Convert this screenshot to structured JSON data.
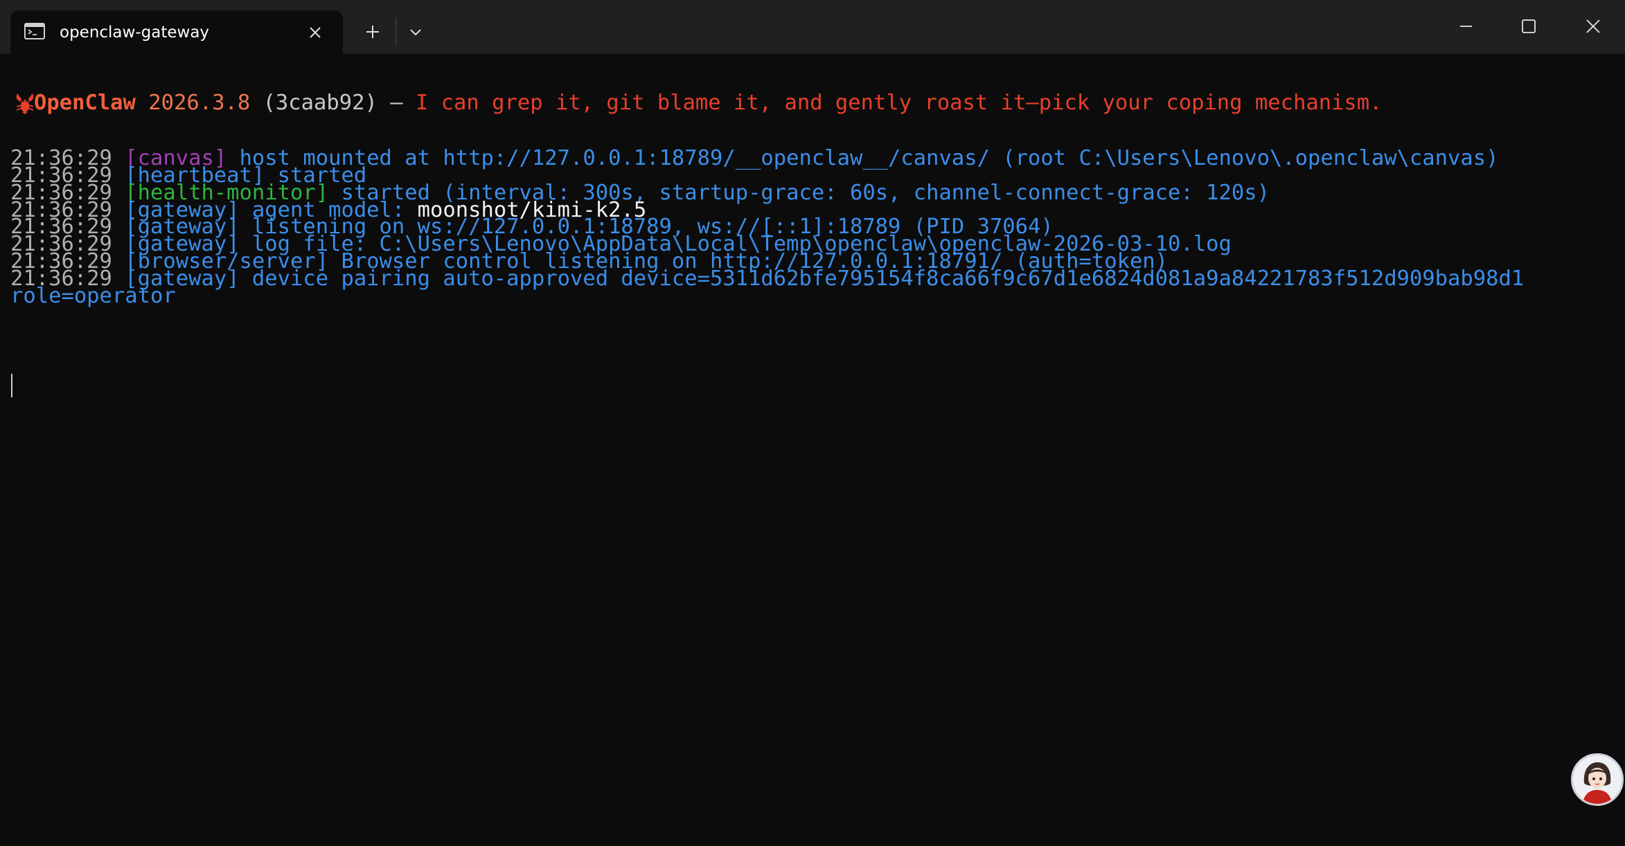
{
  "window": {
    "tab_title": "openclaw-gateway",
    "icons": {
      "tab_icon": "terminal-icon",
      "close_tab": "close-icon",
      "new_tab": "plus-icon",
      "dropdown": "chevron-down-icon",
      "minimize": "minimize-icon",
      "maximize": "maximize-icon",
      "close_window": "close-icon"
    }
  },
  "banner": {
    "icon": "lobster-icon",
    "name": "OpenClaw",
    "version": "2026.3.8",
    "commit": "(3caab92)",
    "dash": "—",
    "tagline": "I can grep it, git blame it, and gently roast it—pick your coping mechanism."
  },
  "log": [
    {
      "time": "21:36:29",
      "tag": "[canvas]",
      "msg": "host mounted at http://127.0.0.1:18789/__openclaw__/canvas/ (root C:\\Users\\Lenovo\\.openclaw\\canvas)"
    },
    {
      "time": "21:36:29",
      "tag": "[heartbeat]",
      "msg": "started"
    },
    {
      "time": "21:36:29",
      "tag": "[health-monitor]",
      "msg": "started (interval: 300s, startup-grace: 60s, channel-connect-grace: 120s)"
    },
    {
      "time": "21:36:29",
      "tag": "[gateway]",
      "msg": "agent model:",
      "value": "moonshot/kimi-k2.5"
    },
    {
      "time": "21:36:29",
      "tag": "[gateway]",
      "msg": "listening on ws://127.0.0.1:18789, ws://[::1]:18789 (PID 37064)"
    },
    {
      "time": "21:36:29",
      "tag": "[gateway]",
      "msg": "log file: C:\\Users\\Lenovo\\AppData\\Local\\Temp\\openclaw\\openclaw-2026-03-10.log"
    },
    {
      "time": "21:36:29",
      "tag": "[browser/server]",
      "msg": "Browser control listening on http://127.0.0.1:18791/ (auth=token)"
    },
    {
      "time": "21:36:29",
      "tag": "[gateway]",
      "msg": "device pairing auto-approved device=5311d62bfe795154f8ca66f9c67d1e6824d081a9a84221783f512d909bab98d1",
      "cont": "role=operator"
    }
  ],
  "colors": {
    "background": "#0c0c0c",
    "titlebar": "#202020",
    "log_blue": "#3b8eea",
    "canvas_purple": "#a23fb4",
    "health_green": "#2fb43f",
    "banner_orange": "#f35e3b"
  },
  "avatar": "user-avatar"
}
